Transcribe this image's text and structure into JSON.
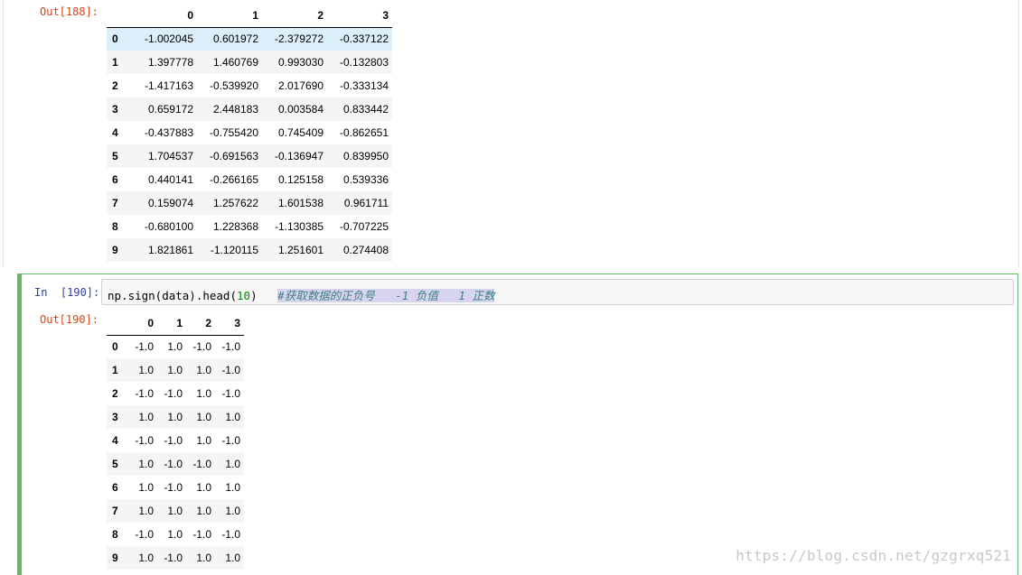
{
  "out188": {
    "prompt": "Out[188]:",
    "columns": [
      "0",
      "1",
      "2",
      "3"
    ],
    "rows": [
      {
        "index": "0",
        "values": [
          "-1.002045",
          "0.601972",
          "-2.379272",
          "-0.337122"
        ]
      },
      {
        "index": "1",
        "values": [
          "1.397778",
          "1.460769",
          "0.993030",
          "-0.132803"
        ]
      },
      {
        "index": "2",
        "values": [
          "-1.417163",
          "-0.539920",
          "2.017690",
          "-0.333134"
        ]
      },
      {
        "index": "3",
        "values": [
          "0.659172",
          "2.448183",
          "0.003584",
          "0.833442"
        ]
      },
      {
        "index": "4",
        "values": [
          "-0.437883",
          "-0.755420",
          "0.745409",
          "-0.862651"
        ]
      },
      {
        "index": "5",
        "values": [
          "1.704537",
          "-0.691563",
          "-0.136947",
          "0.839950"
        ]
      },
      {
        "index": "6",
        "values": [
          "0.440141",
          "-0.266165",
          "0.125158",
          "0.539336"
        ]
      },
      {
        "index": "7",
        "values": [
          "0.159074",
          "1.257622",
          "1.601538",
          "0.961711"
        ]
      },
      {
        "index": "8",
        "values": [
          "-0.680100",
          "1.228368",
          "-1.130385",
          "-0.707225"
        ]
      },
      {
        "index": "9",
        "values": [
          "1.821861",
          "-1.120115",
          "1.251601",
          "0.274408"
        ]
      }
    ]
  },
  "in190": {
    "prompt": "In  [190]:",
    "code_prefix": "np.sign(data).head(",
    "code_number": "10",
    "code_suffix": ")   ",
    "code_comment": "#获取数据的正负号   -1 负值   1 正数"
  },
  "out190": {
    "prompt": "Out[190]:",
    "columns": [
      "0",
      "1",
      "2",
      "3"
    ],
    "rows": [
      {
        "index": "0",
        "values": [
          "-1.0",
          "1.0",
          "-1.0",
          "-1.0"
        ]
      },
      {
        "index": "1",
        "values": [
          "1.0",
          "1.0",
          "1.0",
          "-1.0"
        ]
      },
      {
        "index": "2",
        "values": [
          "-1.0",
          "-1.0",
          "1.0",
          "-1.0"
        ]
      },
      {
        "index": "3",
        "values": [
          "1.0",
          "1.0",
          "1.0",
          "1.0"
        ]
      },
      {
        "index": "4",
        "values": [
          "-1.0",
          "-1.0",
          "1.0",
          "-1.0"
        ]
      },
      {
        "index": "5",
        "values": [
          "1.0",
          "-1.0",
          "-1.0",
          "1.0"
        ]
      },
      {
        "index": "6",
        "values": [
          "1.0",
          "-1.0",
          "1.0",
          "1.0"
        ]
      },
      {
        "index": "7",
        "values": [
          "1.0",
          "1.0",
          "1.0",
          "1.0"
        ]
      },
      {
        "index": "8",
        "values": [
          "-1.0",
          "1.0",
          "-1.0",
          "-1.0"
        ]
      },
      {
        "index": "9",
        "values": [
          "1.0",
          "-1.0",
          "1.0",
          "1.0"
        ]
      }
    ]
  },
  "watermark": "https://blog.csdn.net/gzgrxq521",
  "colors": {
    "out_prompt": "#d84315",
    "in_prompt": "#303f9f",
    "selected_cell_border": "#66bb6a",
    "row_highlight": "#ddeefb"
  }
}
